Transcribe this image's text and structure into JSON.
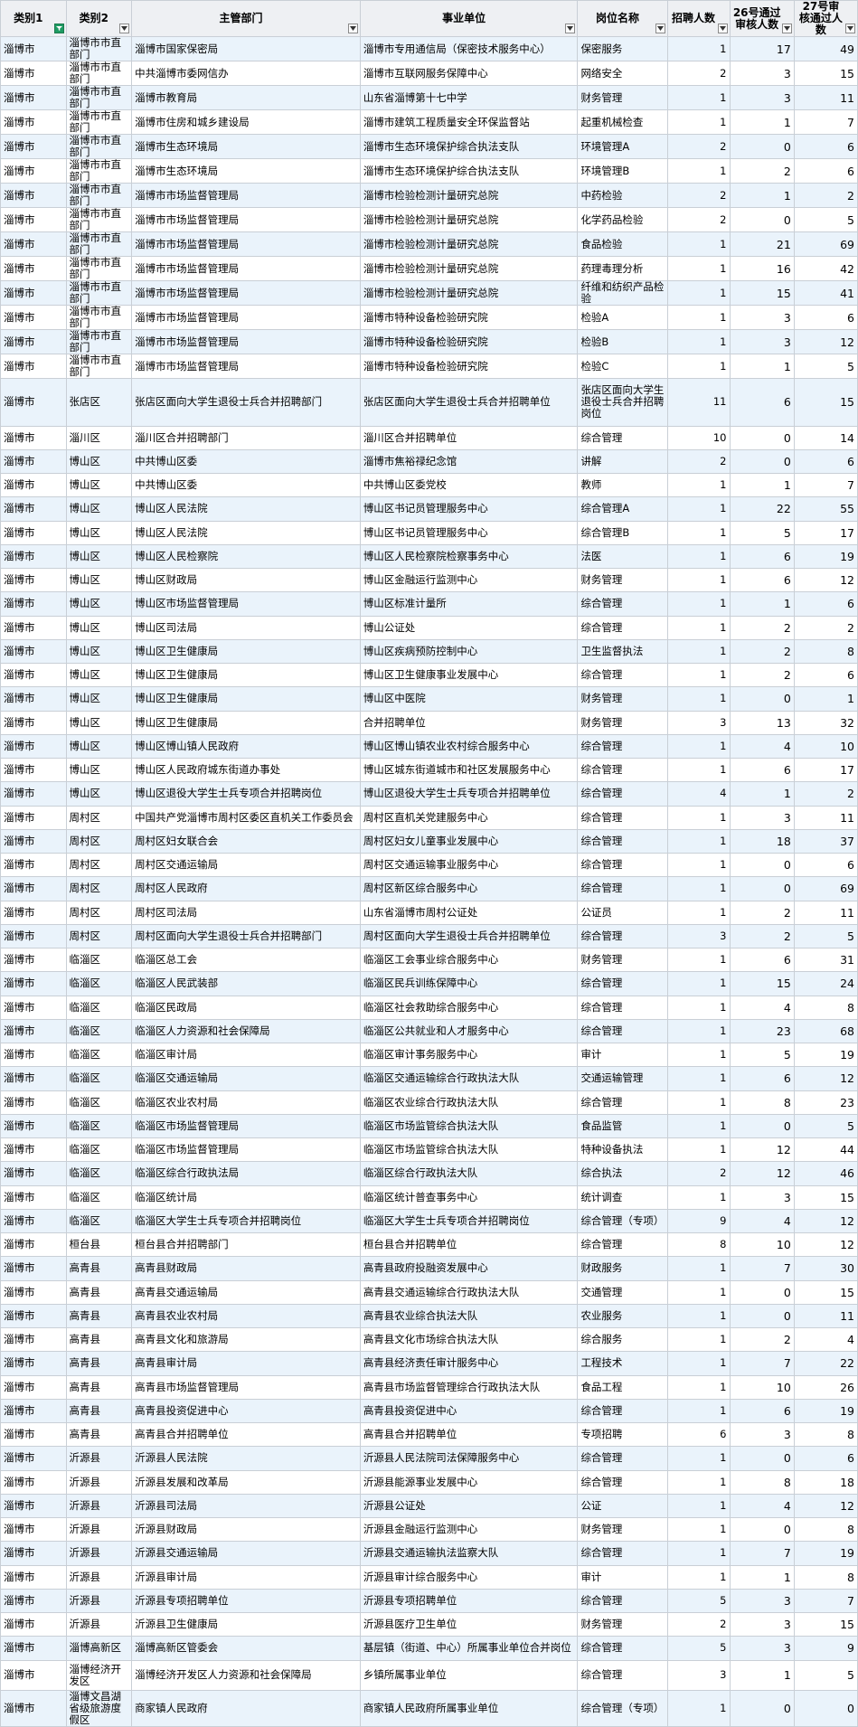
{
  "columns": [
    "类别1",
    "类别2",
    "主管部门",
    "事业单位",
    "岗位名称",
    "招聘人数",
    "26号通过审核人数",
    "27号审核通过人数"
  ],
  "rows": [
    [
      "淄博市",
      "淄博市市直部门",
      "淄博市国家保密局",
      "淄博市专用通信局（保密技术服务中心）",
      "保密服务",
      "1",
      "17",
      "49"
    ],
    [
      "淄博市",
      "淄博市市直部门",
      "中共淄博市委网信办",
      "淄博市互联网服务保障中心",
      "网络安全",
      "2",
      "3",
      "15"
    ],
    [
      "淄博市",
      "淄博市市直部门",
      "淄博市教育局",
      "山东省淄博第十七中学",
      "财务管理",
      "1",
      "3",
      "11"
    ],
    [
      "淄博市",
      "淄博市市直部门",
      "淄博市住房和城乡建设局",
      "淄博市建筑工程质量安全环保监督站",
      "起重机械检查",
      "1",
      "1",
      "7"
    ],
    [
      "淄博市",
      "淄博市市直部门",
      "淄博市生态环境局",
      "淄博市生态环境保护综合执法支队",
      "环境管理A",
      "2",
      "0",
      "6"
    ],
    [
      "淄博市",
      "淄博市市直部门",
      "淄博市生态环境局",
      "淄博市生态环境保护综合执法支队",
      "环境管理B",
      "1",
      "2",
      "6"
    ],
    [
      "淄博市",
      "淄博市市直部门",
      "淄博市市场监督管理局",
      "淄博市检验检测计量研究总院",
      "中药检验",
      "2",
      "1",
      "2"
    ],
    [
      "淄博市",
      "淄博市市直部门",
      "淄博市市场监督管理局",
      "淄博市检验检测计量研究总院",
      "化学药品检验",
      "2",
      "0",
      "5"
    ],
    [
      "淄博市",
      "淄博市市直部门",
      "淄博市市场监督管理局",
      "淄博市检验检测计量研究总院",
      "食品检验",
      "1",
      "21",
      "69"
    ],
    [
      "淄博市",
      "淄博市市直部门",
      "淄博市市场监督管理局",
      "淄博市检验检测计量研究总院",
      "药理毒理分析",
      "1",
      "16",
      "42"
    ],
    [
      "淄博市",
      "淄博市市直部门",
      "淄博市市场监督管理局",
      "淄博市检验检测计量研究总院",
      "纤维和纺织产品检验",
      "1",
      "15",
      "41"
    ],
    [
      "淄博市",
      "淄博市市直部门",
      "淄博市市场监督管理局",
      "淄博市特种设备检验研究院",
      "检验A",
      "1",
      "3",
      "6"
    ],
    [
      "淄博市",
      "淄博市市直部门",
      "淄博市市场监督管理局",
      "淄博市特种设备检验研究院",
      "检验B",
      "1",
      "3",
      "12"
    ],
    [
      "淄博市",
      "淄博市市直部门",
      "淄博市市场监督管理局",
      "淄博市特种设备检验研究院",
      "检验C",
      "1",
      "1",
      "5"
    ],
    [
      "淄博市",
      "张店区",
      "张店区面向大学生退役士兵合并招聘部门",
      "张店区面向大学生退役士兵合并招聘单位",
      "张店区面向大学生退役士兵合并招聘岗位",
      "11",
      "6",
      "15"
    ],
    [
      "淄博市",
      "淄川区",
      "淄川区合并招聘部门",
      "淄川区合并招聘单位",
      "综合管理",
      "10",
      "0",
      "14"
    ],
    [
      "淄博市",
      "博山区",
      "中共博山区委",
      "淄博市焦裕禄纪念馆",
      "讲解",
      "2",
      "0",
      "6"
    ],
    [
      "淄博市",
      "博山区",
      "中共博山区委",
      "中共博山区委党校",
      "教师",
      "1",
      "1",
      "7"
    ],
    [
      "淄博市",
      "博山区",
      "博山区人民法院",
      "博山区书记员管理服务中心",
      "综合管理A",
      "1",
      "22",
      "55"
    ],
    [
      "淄博市",
      "博山区",
      "博山区人民法院",
      "博山区书记员管理服务中心",
      "综合管理B",
      "1",
      "5",
      "17"
    ],
    [
      "淄博市",
      "博山区",
      "博山区人民检察院",
      "博山区人民检察院检察事务中心",
      "法医",
      "1",
      "6",
      "19"
    ],
    [
      "淄博市",
      "博山区",
      "博山区财政局",
      "博山区金融运行监测中心",
      "财务管理",
      "1",
      "6",
      "12"
    ],
    [
      "淄博市",
      "博山区",
      "博山区市场监督管理局",
      "博山区标准计量所",
      "综合管理",
      "1",
      "1",
      "6"
    ],
    [
      "淄博市",
      "博山区",
      "博山区司法局",
      "博山公证处",
      "综合管理",
      "1",
      "2",
      "2"
    ],
    [
      "淄博市",
      "博山区",
      "博山区卫生健康局",
      "博山区疾病预防控制中心",
      "卫生监督执法",
      "1",
      "2",
      "8"
    ],
    [
      "淄博市",
      "博山区",
      "博山区卫生健康局",
      "博山区卫生健康事业发展中心",
      "综合管理",
      "1",
      "2",
      "6"
    ],
    [
      "淄博市",
      "博山区",
      "博山区卫生健康局",
      "博山区中医院",
      "财务管理",
      "1",
      "0",
      "1"
    ],
    [
      "淄博市",
      "博山区",
      "博山区卫生健康局",
      "合并招聘单位",
      "财务管理",
      "3",
      "13",
      "32"
    ],
    [
      "淄博市",
      "博山区",
      "博山区博山镇人民政府",
      "博山区博山镇农业农村综合服务中心",
      "综合管理",
      "1",
      "4",
      "10"
    ],
    [
      "淄博市",
      "博山区",
      "博山区人民政府城东街道办事处",
      "博山区城东街道城市和社区发展服务中心",
      "综合管理",
      "1",
      "6",
      "17"
    ],
    [
      "淄博市",
      "博山区",
      "博山区退役大学生士兵专项合并招聘岗位",
      "博山区退役大学生士兵专项合并招聘单位",
      "综合管理",
      "4",
      "1",
      "2"
    ],
    [
      "淄博市",
      "周村区",
      "中国共产党淄博市周村区委区直机关工作委员会",
      "周村区直机关党建服务中心",
      "综合管理",
      "1",
      "3",
      "11"
    ],
    [
      "淄博市",
      "周村区",
      "周村区妇女联合会",
      "周村区妇女儿童事业发展中心",
      "综合管理",
      "1",
      "18",
      "37"
    ],
    [
      "淄博市",
      "周村区",
      "周村区交通运输局",
      "周村区交通运输事业服务中心",
      "综合管理",
      "1",
      "0",
      "6"
    ],
    [
      "淄博市",
      "周村区",
      "周村区人民政府",
      "周村区新区综合服务中心",
      "综合管理",
      "1",
      "0",
      "69"
    ],
    [
      "淄博市",
      "周村区",
      "周村区司法局",
      "山东省淄博市周村公证处",
      "公证员",
      "1",
      "2",
      "11"
    ],
    [
      "淄博市",
      "周村区",
      "周村区面向大学生退役士兵合并招聘部门",
      "周村区面向大学生退役士兵合并招聘单位",
      "综合管理",
      "3",
      "2",
      "5"
    ],
    [
      "淄博市",
      "临淄区",
      "临淄区总工会",
      "临淄区工会事业综合服务中心",
      "财务管理",
      "1",
      "6",
      "31"
    ],
    [
      "淄博市",
      "临淄区",
      "临淄区人民武装部",
      "临淄区民兵训练保障中心",
      "综合管理",
      "1",
      "15",
      "24"
    ],
    [
      "淄博市",
      "临淄区",
      "临淄区民政局",
      "临淄区社会救助综合服务中心",
      "综合管理",
      "1",
      "4",
      "8"
    ],
    [
      "淄博市",
      "临淄区",
      "临淄区人力资源和社会保障局",
      "临淄区公共就业和人才服务中心",
      "综合管理",
      "1",
      "23",
      "68"
    ],
    [
      "淄博市",
      "临淄区",
      "临淄区审计局",
      "临淄区审计事务服务中心",
      "审计",
      "1",
      "5",
      "19"
    ],
    [
      "淄博市",
      "临淄区",
      "临淄区交通运输局",
      "临淄区交通运输综合行政执法大队",
      "交通运输管理",
      "1",
      "6",
      "12"
    ],
    [
      "淄博市",
      "临淄区",
      "临淄区农业农村局",
      "临淄区农业综合行政执法大队",
      "综合管理",
      "1",
      "8",
      "23"
    ],
    [
      "淄博市",
      "临淄区",
      "临淄区市场监督管理局",
      "临淄区市场监管综合执法大队",
      "食品监管",
      "1",
      "0",
      "5"
    ],
    [
      "淄博市",
      "临淄区",
      "临淄区市场监督管理局",
      "临淄区市场监管综合执法大队",
      "特种设备执法",
      "1",
      "12",
      "44"
    ],
    [
      "淄博市",
      "临淄区",
      "临淄区综合行政执法局",
      "临淄区综合行政执法大队",
      "综合执法",
      "2",
      "12",
      "46"
    ],
    [
      "淄博市",
      "临淄区",
      "临淄区统计局",
      "临淄区统计普查事务中心",
      "统计调查",
      "1",
      "3",
      "15"
    ],
    [
      "淄博市",
      "临淄区",
      "临淄区大学生士兵专项合并招聘岗位",
      "临淄区大学生士兵专项合并招聘岗位",
      "综合管理（专项）",
      "9",
      "4",
      "12"
    ],
    [
      "淄博市",
      "桓台县",
      "桓台县合并招聘部门",
      "桓台县合并招聘单位",
      "综合管理",
      "8",
      "10",
      "12"
    ],
    [
      "淄博市",
      "高青县",
      "高青县财政局",
      "高青县政府投融资发展中心",
      "财政服务",
      "1",
      "7",
      "30"
    ],
    [
      "淄博市",
      "高青县",
      "高青县交通运输局",
      "高青县交通运输综合行政执法大队",
      "交通管理",
      "1",
      "0",
      "15"
    ],
    [
      "淄博市",
      "高青县",
      "高青县农业农村局",
      "高青县农业综合执法大队",
      "农业服务",
      "1",
      "0",
      "11"
    ],
    [
      "淄博市",
      "高青县",
      "高青县文化和旅游局",
      "高青县文化市场综合执法大队",
      "综合服务",
      "1",
      "2",
      "4"
    ],
    [
      "淄博市",
      "高青县",
      "高青县审计局",
      "高青县经济责任审计服务中心",
      "工程技术",
      "1",
      "7",
      "22"
    ],
    [
      "淄博市",
      "高青县",
      "高青县市场监督管理局",
      "高青县市场监督管理综合行政执法大队",
      "食品工程",
      "1",
      "10",
      "26"
    ],
    [
      "淄博市",
      "高青县",
      "高青县投资促进中心",
      "高青县投资促进中心",
      "综合管理",
      "1",
      "6",
      "19"
    ],
    [
      "淄博市",
      "高青县",
      "高青县合并招聘单位",
      "高青县合并招聘单位",
      "专项招聘",
      "6",
      "3",
      "8"
    ],
    [
      "淄博市",
      "沂源县",
      "沂源县人民法院",
      "沂源县人民法院司法保障服务中心",
      "综合管理",
      "1",
      "0",
      "6"
    ],
    [
      "淄博市",
      "沂源县",
      "沂源县发展和改革局",
      "沂源县能源事业发展中心",
      "综合管理",
      "1",
      "8",
      "18"
    ],
    [
      "淄博市",
      "沂源县",
      "沂源县司法局",
      "沂源县公证处",
      "公证",
      "1",
      "4",
      "12"
    ],
    [
      "淄博市",
      "沂源县",
      "沂源县财政局",
      "沂源县金融运行监测中心",
      "财务管理",
      "1",
      "0",
      "8"
    ],
    [
      "淄博市",
      "沂源县",
      "沂源县交通运输局",
      "沂源县交通运输执法监察大队",
      "综合管理",
      "1",
      "7",
      "19"
    ],
    [
      "淄博市",
      "沂源县",
      "沂源县审计局",
      "沂源县审计综合服务中心",
      "审计",
      "1",
      "1",
      "8"
    ],
    [
      "淄博市",
      "沂源县",
      "沂源县专项招聘单位",
      "沂源县专项招聘单位",
      "综合管理",
      "5",
      "3",
      "7"
    ],
    [
      "淄博市",
      "沂源县",
      "沂源县卫生健康局",
      "沂源县医疗卫生单位",
      "财务管理",
      "2",
      "3",
      "15"
    ],
    [
      "淄博市",
      "淄博高新区",
      "淄博高新区管委会",
      "基层镇（街道、中心）所属事业单位合并岗位",
      "综合管理",
      "5",
      "3",
      "9"
    ],
    [
      "淄博市",
      "淄博经济开发区",
      "淄博经济开发区人力资源和社会保障局",
      "乡镇所属事业单位",
      "综合管理",
      "3",
      "1",
      "5"
    ],
    [
      "淄博市",
      "淄博文昌湖省级旅游度假区",
      "商家镇人民政府",
      "商家镇人民政府所属事业单位",
      "综合管理（专项）",
      "1",
      "0",
      "0"
    ]
  ]
}
